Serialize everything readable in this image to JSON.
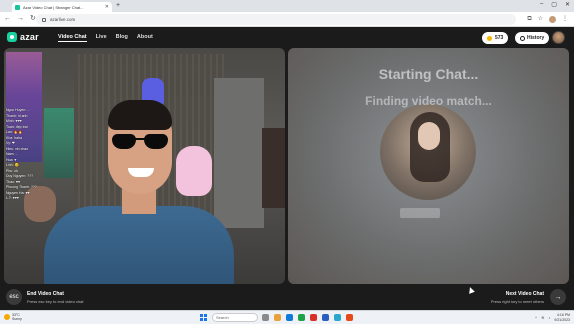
{
  "browser": {
    "tab_title": "Azar Video Chat | Stranger Chat...",
    "url": "azarlive.com",
    "new_tab": "+",
    "window_controls": [
      "–",
      "▢",
      "✕"
    ]
  },
  "app": {
    "logo": "azar",
    "menu": [
      {
        "label": "Video Chat",
        "active": true
      },
      {
        "label": "Live"
      },
      {
        "label": "Blog"
      },
      {
        "label": "About"
      }
    ],
    "gems": "573",
    "history_label": "History"
  },
  "left_panel": {
    "chat_lines": [
      "Ngoc Huyen: ...",
      "Thanh: hi anh",
      "Minh: ♥♥♥",
      "Tuan: đẹp trai",
      "Lan: 🔥🔥",
      "Kha: haha",
      "Vy: ❤",
      "Hieu: xin chao",
      "Nam: ...",
      "Hoa: ♥",
      "Linh: 😊",
      "Phu: ok",
      "Duy Nguyen: ???",
      "Thao: ♥♥",
      "Phuong Thanh: ???",
      "Nguyen Ha: ♥♥",
      "L.T: ♥♥♥"
    ]
  },
  "right_panel": {
    "starting": "Starting Chat...",
    "finding": "Finding video match..."
  },
  "actions": {
    "end_label": "End Video Chat",
    "end_hint": "Press esc key to end video chat",
    "next_label": "Next Video Chat",
    "next_hint": "Press right key to meet others"
  },
  "taskbar": {
    "weather_temp": "33°C",
    "weather_desc": "Sunny",
    "search_placeholder": "Search",
    "time": "4:16 PM",
    "date": "9/21/2023"
  },
  "colors": {
    "brand": "#17d1a1",
    "bg": "#1b1b1b",
    "gem": "#f5b700"
  }
}
